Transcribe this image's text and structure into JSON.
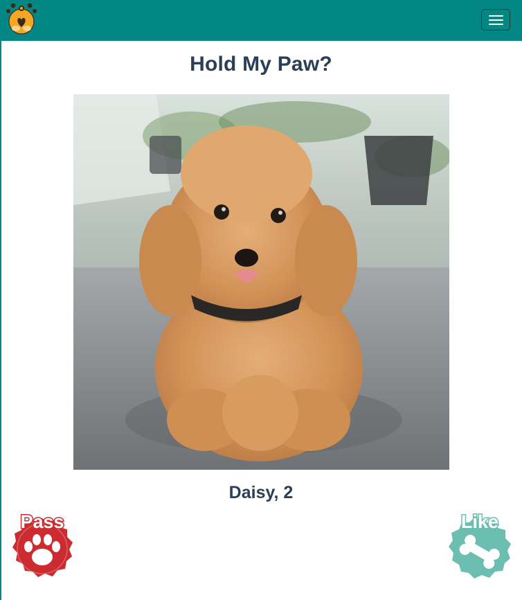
{
  "nav": {
    "logo_icon": "paws-in-love-logo-icon",
    "menu_icon": "hamburger-menu-icon",
    "colors": {
      "bar": "#038785"
    }
  },
  "main": {
    "title": "Hold My Paw?",
    "pet": {
      "name_age": "Daisy, 2",
      "photo_description": "fluffy apricot toy poodle puppy"
    }
  },
  "actions": {
    "pass": {
      "label": "Pass",
      "icon": "paw-print-icon",
      "color": "#cc2b2f"
    },
    "like": {
      "label": "Like",
      "icon": "bone-icon",
      "color": "#6cbfb0"
    }
  }
}
